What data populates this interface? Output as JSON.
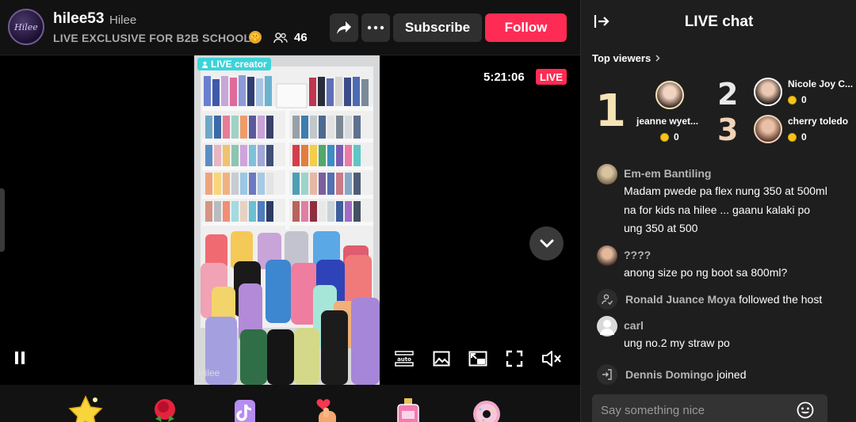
{
  "header": {
    "host_name": "hilee53",
    "host_nickname": "Hilee",
    "live_title": "LIVE EXCLUSIVE FOR B2B SCHOOL",
    "viewer_count": "46",
    "subscribe_label": "Subscribe",
    "follow_label": "Follow",
    "icons": [
      "share-icon",
      "more-icon",
      "people-icon"
    ]
  },
  "player": {
    "creator_badge": "LIVE creator",
    "watermark": "Hilee",
    "elapsed_time": "5:21:06",
    "live_label": "LIVE",
    "controls": [
      "pause-icon",
      "auto-quality-icon",
      "picture-icon",
      "pip-icon",
      "fullscreen-icon",
      "mute-icon"
    ]
  },
  "gifts": [
    "star-gift",
    "rose-gift",
    "tiktok-gift",
    "finger-heart-gift",
    "perfume-gift",
    "donut-gift"
  ],
  "chat": {
    "title": "LIVE chat",
    "top_viewers_label": "Top viewers",
    "top_viewers": [
      {
        "rank": "1",
        "name": "jeanne wyet...",
        "coins": "0"
      },
      {
        "rank": "2",
        "name": "Nicole Joy C...",
        "coins": "0"
      },
      {
        "rank": "3",
        "name": "cherry toledo",
        "coins": "0"
      }
    ],
    "messages": [
      {
        "user": "Em-em Bantiling",
        "text": "Madam pwede pa flex nung 350 at 500ml na for kids na hilee ... gaanu kalaki po ung 350 at 500"
      },
      {
        "user": "????",
        "text": "anong size po ng boot sa 800ml?"
      },
      {
        "user": "carl",
        "text": "ung no.2 my straw po"
      }
    ],
    "events": [
      {
        "user": "Ronald Juance Moya",
        "action": "followed the host"
      },
      {
        "user": "Dennis Domingo",
        "action": "joined"
      }
    ],
    "input_placeholder": "Say something nice"
  },
  "colors": {
    "accent": "#fe2c55",
    "creator_badge": "#3dd3d9",
    "coin": "#f5c518"
  }
}
